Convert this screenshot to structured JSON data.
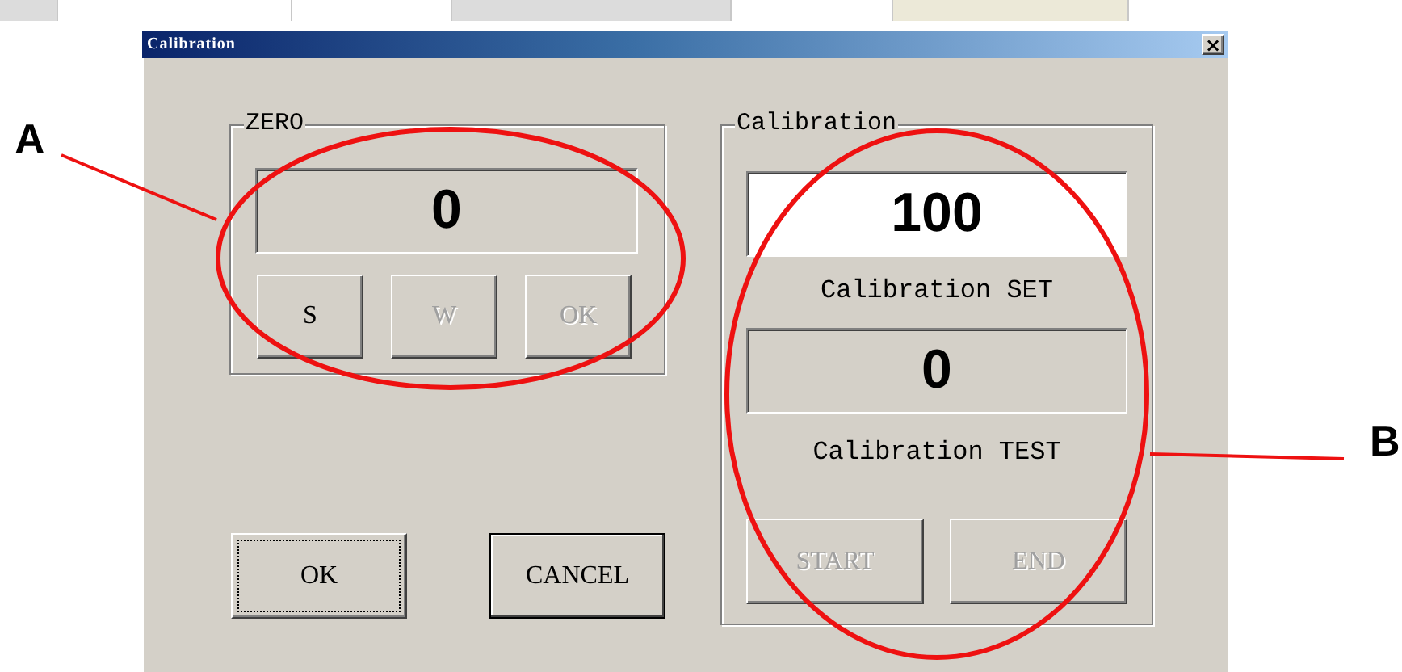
{
  "window": {
    "title": "Calibration",
    "close": "×"
  },
  "zero_group": {
    "title": "ZERO",
    "reading": "0",
    "buttons": [
      {
        "label": "S",
        "disabled": false
      },
      {
        "label": "W",
        "disabled": true
      },
      {
        "label": "OK",
        "disabled": true
      }
    ]
  },
  "calibration_group": {
    "title": "Calibration",
    "fields": [
      {
        "kind": "input",
        "value": "100",
        "caption": "Calibration SET"
      },
      {
        "kind": "readout",
        "value": "0",
        "caption": "Calibration TEST"
      }
    ],
    "buttons": [
      {
        "label": "START",
        "disabled": true
      },
      {
        "label": "END",
        "disabled": true
      }
    ]
  },
  "dialog_buttons": [
    {
      "label": "OK",
      "focused": true,
      "default": false
    },
    {
      "label": "CANCEL",
      "focused": false,
      "default": true
    }
  ],
  "annotations": [
    {
      "label": "A"
    },
    {
      "label": "B"
    }
  ]
}
